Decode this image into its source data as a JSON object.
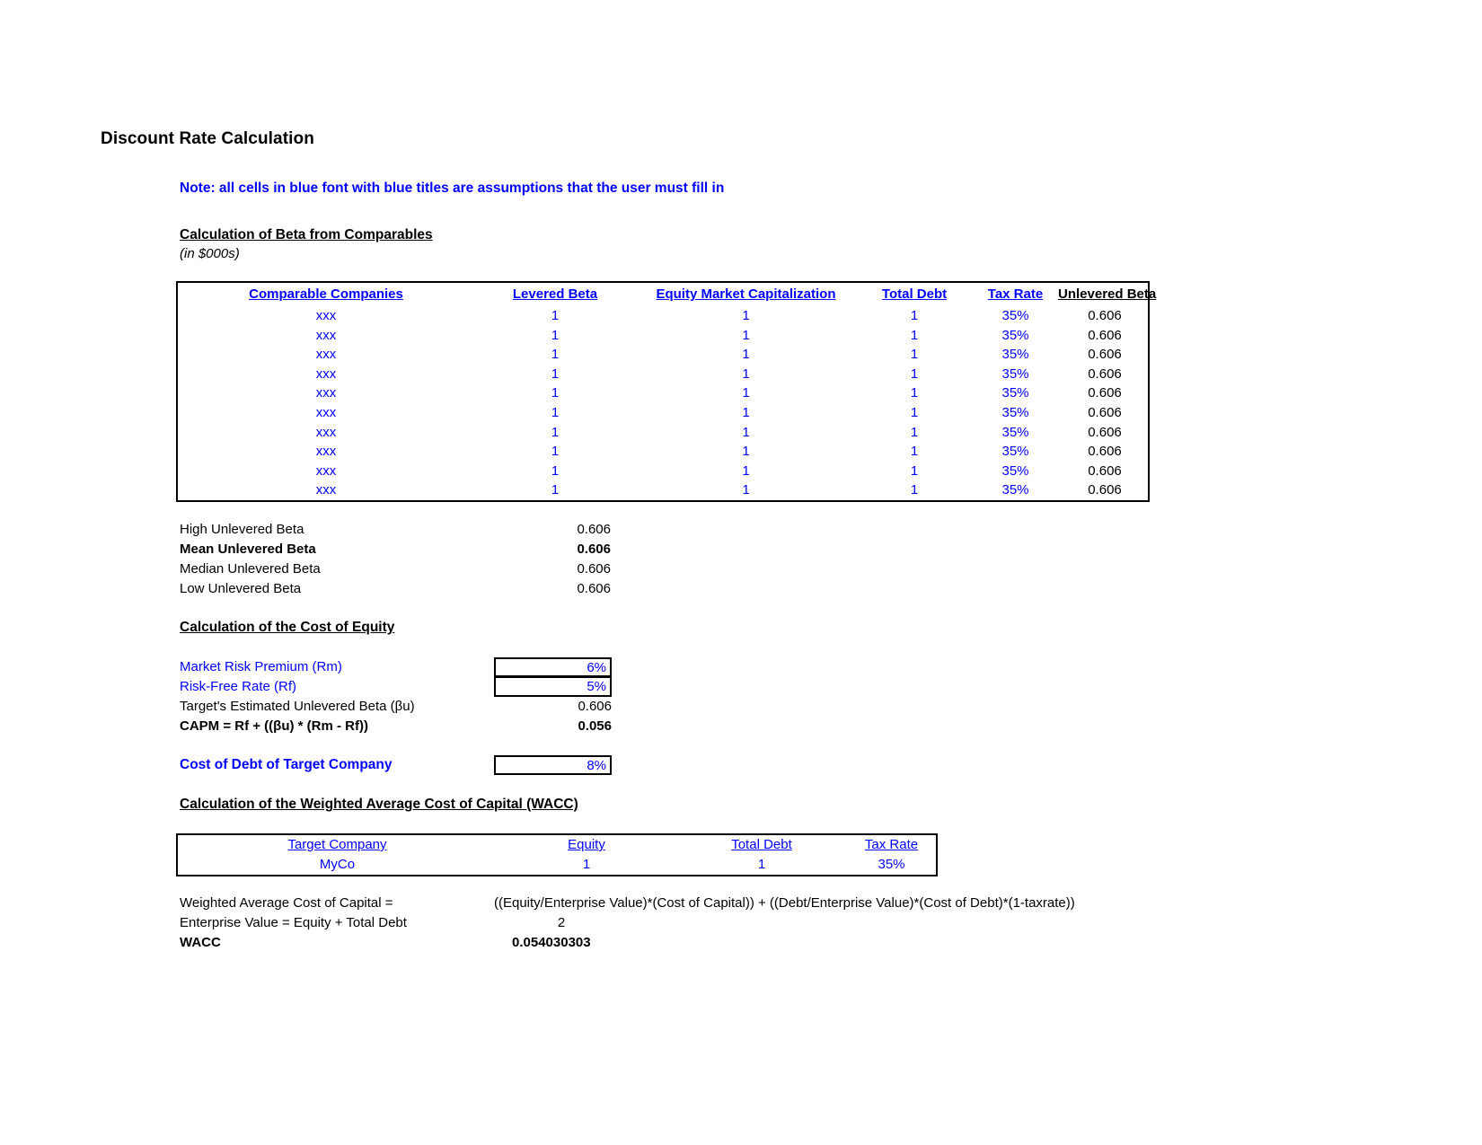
{
  "page": {
    "title": "Discount Rate Calculation",
    "note": "Note: all cells in blue font with blue titles are assumptions that the user must fill in",
    "accent_blue": "#0000ff",
    "text_black": "#000000"
  },
  "beta_section": {
    "heading": "Calculation of Beta from Comparables",
    "units": "(in $000s)",
    "table": {
      "headers": [
        "Comparable Companies",
        "Levered Beta",
        "Equity Market Capitalization",
        "Total Debt",
        "Tax Rate",
        "Unlevered Beta"
      ],
      "rows": [
        [
          "xxx",
          "1",
          "1",
          "1",
          "35%",
          "0.606"
        ],
        [
          "xxx",
          "1",
          "1",
          "1",
          "35%",
          "0.606"
        ],
        [
          "xxx",
          "1",
          "1",
          "1",
          "35%",
          "0.606"
        ],
        [
          "xxx",
          "1",
          "1",
          "1",
          "35%",
          "0.606"
        ],
        [
          "xxx",
          "1",
          "1",
          "1",
          "35%",
          "0.606"
        ],
        [
          "xxx",
          "1",
          "1",
          "1",
          "35%",
          "0.606"
        ],
        [
          "xxx",
          "1",
          "1",
          "1",
          "35%",
          "0.606"
        ],
        [
          "xxx",
          "1",
          "1",
          "1",
          "35%",
          "0.606"
        ],
        [
          "xxx",
          "1",
          "1",
          "1",
          "35%",
          "0.606"
        ],
        [
          "xxx",
          "1",
          "1",
          "1",
          "35%",
          "0.606"
        ]
      ]
    },
    "stats": [
      {
        "label": "High Unlevered Beta",
        "value": "0.606",
        "bold": false
      },
      {
        "label": "Mean Unlevered Beta",
        "value": "0.606",
        "bold": true
      },
      {
        "label": "Median Unlevered Beta",
        "value": "0.606",
        "bold": false
      },
      {
        "label": "Low Unlevered Beta",
        "value": "0.606",
        "bold": false
      }
    ]
  },
  "cost_of_equity": {
    "heading": "Calculation of the Cost of Equity",
    "market_risk_premium_label": "Market Risk Premium (Rm)",
    "market_risk_premium_value": "6%",
    "risk_free_rate_label": "Risk-Free Rate (Rf)",
    "risk_free_rate_value": "5%",
    "target_unlevered_beta_label": "Target's Estimated Unlevered Beta (βu)",
    "target_unlevered_beta_value": "0.606",
    "capm_label": "CAPM = Rf + ((βu) * (Rm - Rf))",
    "capm_value": "0.056"
  },
  "cost_of_debt": {
    "label": "Cost of Debt of Target Company",
    "value": "8%"
  },
  "wacc_section": {
    "heading": "Calculation of the Weighted Average Cost of Capital (WACC)",
    "table": {
      "headers": [
        "Target Company",
        "Equity",
        "Total Debt",
        "Tax Rate"
      ],
      "rows": [
        [
          "MyCo",
          "1",
          "1",
          "35%"
        ]
      ]
    },
    "wacc_formula_label": "Weighted Average Cost of Capital =",
    "wacc_formula_text": "((Equity/Enterprise Value)*(Cost of Capital)) + ((Debt/Enterprise Value)*(Cost of Debt)*(1-taxrate))",
    "enterprise_value_label": "Enterprise Value = Equity + Total Debt",
    "enterprise_value_value": "2",
    "wacc_label": "WACC",
    "wacc_value": "0.054030303"
  }
}
